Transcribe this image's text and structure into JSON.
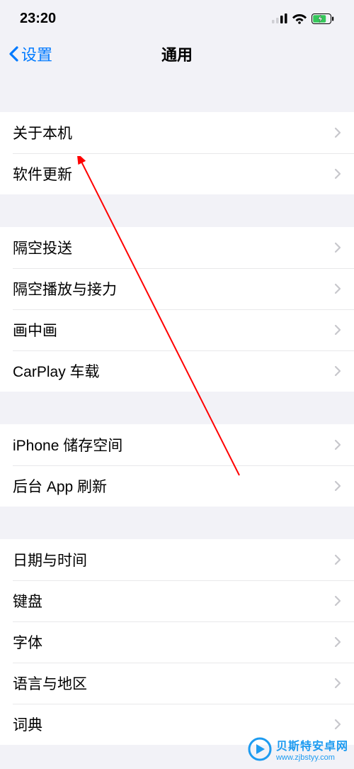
{
  "status": {
    "time": "23:20"
  },
  "nav": {
    "back_label": "设置",
    "title": "通用"
  },
  "groups": [
    {
      "items": [
        "关于本机",
        "软件更新"
      ]
    },
    {
      "items": [
        "隔空投送",
        "隔空播放与接力",
        "画中画",
        "CarPlay 车载"
      ]
    },
    {
      "items": [
        "iPhone 储存空间",
        "后台 App 刷新"
      ]
    },
    {
      "items": [
        "日期与时间",
        "键盘",
        "字体",
        "语言与地区",
        "词典"
      ]
    }
  ],
  "watermark": {
    "line1": "贝斯特安卓网",
    "line2": "www.zjbstyy.com"
  },
  "colors": {
    "accent": "#007aff",
    "annotation": "#ff0000",
    "watermark": "#1d9bf0"
  }
}
